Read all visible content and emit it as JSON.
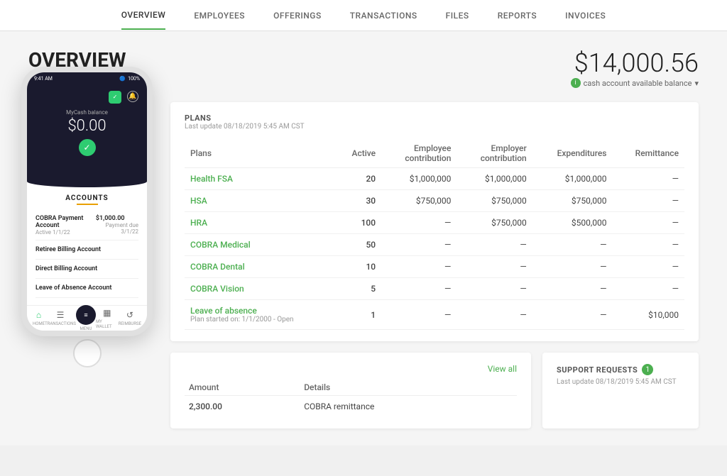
{
  "nav": {
    "items": [
      {
        "label": "OVERVIEW",
        "active": true
      },
      {
        "label": "EMPLOYEES",
        "active": false
      },
      {
        "label": "OFFERINGS",
        "active": false
      },
      {
        "label": "TRANSACTIONS",
        "active": false
      },
      {
        "label": "FILES",
        "active": false
      },
      {
        "label": "REPORTS",
        "active": false
      },
      {
        "label": "INVOICES",
        "active": false
      }
    ]
  },
  "overview": {
    "title": "OVERVIEW",
    "balance": "$14,000.56",
    "balance_label": "cash account available balance",
    "last_updated": "Last update 08/18/2019 5:45 AM CST"
  },
  "plans": {
    "section_title": "PLANS",
    "last_updated": "Last update 08/18/2019 5:45 AM CST",
    "columns": {
      "plans": "Plans",
      "active": "Active",
      "employee_contribution": "Employee contribution",
      "employer_contribution": "Employer contribution",
      "expenditures": "Expenditures",
      "remittance": "Remittance"
    },
    "rows": [
      {
        "name": "Health FSA",
        "active": "20",
        "employee_contribution": "$1,000,000",
        "employer_contribution": "$1,000,000",
        "expenditures": "$1,000,000",
        "remittance": "—",
        "subtext": ""
      },
      {
        "name": "HSA",
        "active": "30",
        "employee_contribution": "$750,000",
        "employer_contribution": "$750,000",
        "expenditures": "$750,000",
        "remittance": "—",
        "subtext": ""
      },
      {
        "name": "HRA",
        "active": "100",
        "employee_contribution": "—",
        "employer_contribution": "$750,000",
        "expenditures": "$500,000",
        "remittance": "—",
        "subtext": ""
      },
      {
        "name": "COBRA Medical",
        "active": "50",
        "employee_contribution": "—",
        "employer_contribution": "—",
        "expenditures": "—",
        "remittance": "—",
        "subtext": ""
      },
      {
        "name": "COBRA Dental",
        "active": "10",
        "employee_contribution": "—",
        "employer_contribution": "—",
        "expenditures": "—",
        "remittance": "—",
        "subtext": ""
      },
      {
        "name": "COBRA Vision",
        "active": "5",
        "employee_contribution": "—",
        "employer_contribution": "—",
        "expenditures": "—",
        "remittance": "—",
        "subtext": ""
      },
      {
        "name": "Leave of absence",
        "active": "1",
        "employee_contribution": "—",
        "employer_contribution": "—",
        "expenditures": "—",
        "remittance": "$10,000",
        "subtext": "Plan started on: 1/1/2000 - Open"
      }
    ]
  },
  "transactions": {
    "view_all": "View all",
    "columns": {
      "amount": "Amount",
      "details": "Details"
    },
    "rows": [
      {
        "amount": "2,300.00",
        "details": "COBRA remittance"
      }
    ]
  },
  "support": {
    "title": "SUPPORT REQUESTS",
    "badge": "1",
    "last_updated": "Last update 08/18/2019 5:45 AM CST"
  },
  "phone": {
    "time": "9:41 AM",
    "wifi": "WiFi",
    "bluetooth": "100%",
    "balance_label": "MyCash balance",
    "balance": "$0.00",
    "accounts_title": "ACCOUNTS",
    "accounts": [
      {
        "name": "COBRA Payment Account",
        "sub": "Active 1/1/22",
        "amount": "$1,000.00",
        "due": "Payment due 3/1/22"
      },
      {
        "name": "Retiree Billing Account",
        "sub": "",
        "amount": "",
        "due": ""
      },
      {
        "name": "Direct Billing Account",
        "sub": "",
        "amount": "",
        "due": ""
      },
      {
        "name": "Leave of Absence Account",
        "sub": "",
        "amount": "",
        "due": ""
      }
    ],
    "footer_items": [
      {
        "label": "HOME",
        "active": true,
        "icon": "⌂"
      },
      {
        "label": "TRANSACTIONS",
        "active": false,
        "icon": "☰"
      },
      {
        "label": "MENU",
        "active": false,
        "icon": ""
      },
      {
        "label": "MY WALLET",
        "active": false,
        "icon": "▦"
      },
      {
        "label": "REIMBURSE",
        "active": false,
        "icon": "↺"
      }
    ]
  }
}
